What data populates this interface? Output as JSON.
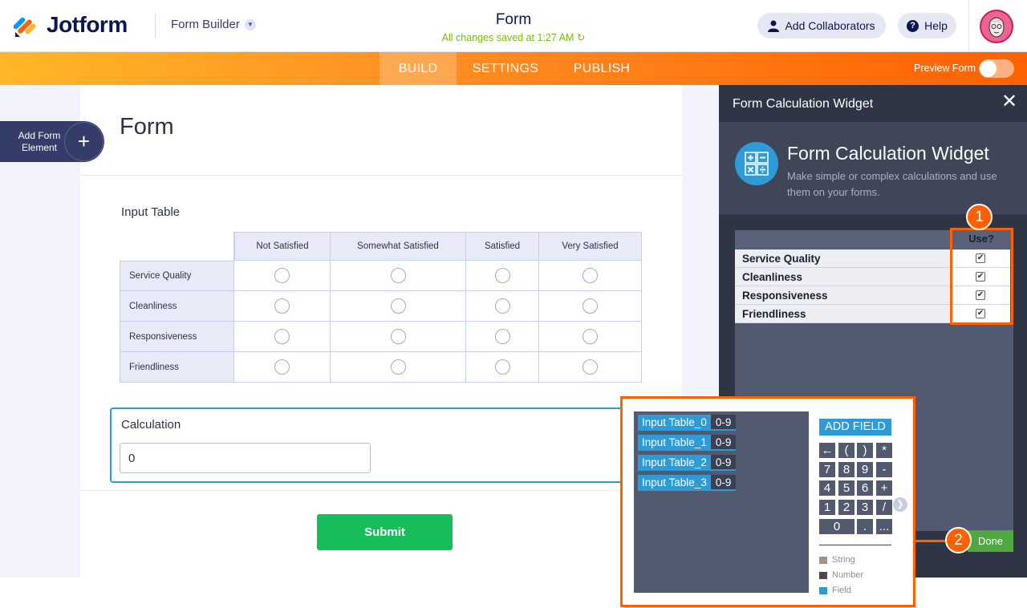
{
  "header": {
    "brand": "Jotform",
    "builder_label": "Form Builder",
    "form_title": "Form",
    "save_status": "All changes saved at 1:27 AM",
    "collaborators_label": "Add Collaborators",
    "help_label": "Help"
  },
  "nav": {
    "tabs": [
      "BUILD",
      "SETTINGS",
      "PUBLISH"
    ],
    "active_tab": "BUILD",
    "preview_label": "Preview Form",
    "preview_enabled": false
  },
  "sidebar": {
    "add_element_label": "Add Form Element"
  },
  "form": {
    "heading": "Form",
    "input_table": {
      "label": "Input Table",
      "columns": [
        "Not Satisfied",
        "Somewhat Satisfied",
        "Satisfied",
        "Very Satisfied"
      ],
      "rows": [
        "Service Quality",
        "Cleanliness",
        "Responsiveness",
        "Friendliness"
      ]
    },
    "calculation": {
      "label": "Calculation",
      "value": "0"
    },
    "submit_label": "Submit"
  },
  "panel": {
    "header_title": "Form Calculation Widget",
    "widget_title": "Form Calculation Widget",
    "widget_description": "Make simple or complex calculations and use them on your forms.",
    "use_header": "Use?",
    "fields": [
      {
        "name": "Service Quality",
        "checked": true
      },
      {
        "name": "Cleanliness",
        "checked": true
      },
      {
        "name": "Responsiveness",
        "checked": true
      },
      {
        "name": "Friendliness",
        "checked": true
      }
    ],
    "done_label": "Done",
    "badges": [
      "1",
      "2"
    ]
  },
  "calculator": {
    "fields": [
      {
        "name": "Input Table_0",
        "range": "0-9"
      },
      {
        "name": "Input Table_1",
        "range": "0-9"
      },
      {
        "name": "Input Table_2",
        "range": "0-9"
      },
      {
        "name": "Input Table_3",
        "range": "0-9"
      }
    ],
    "add_field_label": "ADD FIELD",
    "keys": [
      [
        "←",
        "(",
        ")",
        "*"
      ],
      [
        "7",
        "8",
        "9",
        "-"
      ],
      [
        "4",
        "5",
        "6",
        "+"
      ],
      [
        "1",
        "2",
        "3",
        "/"
      ],
      [
        "0",
        ".",
        "..."
      ]
    ],
    "legend": [
      {
        "label": "String",
        "color": "#a39384"
      },
      {
        "label": "Number",
        "color": "#4a4a4a"
      },
      {
        "label": "Field",
        "color": "#2e9bd6"
      }
    ]
  },
  "colors": {
    "accent_orange": "#ff6100",
    "brand_blue": "#2e9bd6",
    "submit_green": "#18bd5b",
    "done_green": "#4fa83d"
  }
}
